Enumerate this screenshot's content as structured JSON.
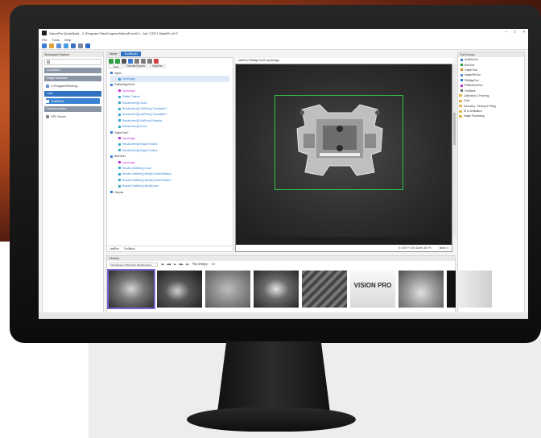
{
  "window": {
    "title": "VisionPro QuickBuild - C:\\Program Files\\Cognex\\VisionPro\\v9.0 - Job \"CFDT-MaskPr v9.0\"",
    "controls": [
      "–",
      "□",
      "×"
    ]
  },
  "menu": [
    "File",
    "Tools",
    "Help"
  ],
  "left_panel": {
    "header": "Workspace Explorer",
    "categories": [
      {
        "label": "Acquisition",
        "active": false
      },
      {
        "label": "Image Database",
        "active": false
      },
      {
        "label": "Jobs",
        "active": true
      },
      {
        "label": "Communication",
        "active": false
      }
    ],
    "items": {
      "image_db": "C:\\Program\\Files\\Img...",
      "job": "ToolBlock1",
      "comm": "OPC Server"
    }
  },
  "doc_tabs": [
    {
      "label": "Home",
      "active": false
    },
    {
      "label": "ToolBlock1",
      "active": true
    }
  ],
  "tree": {
    "tabs": [
      "Tools",
      "Results/Outputs",
      "Graphics"
    ],
    "nodes": [
      {
        "text": "Inputs",
        "level": 0
      },
      {
        "text": "InputImage",
        "level": 1,
        "style": "sel"
      },
      {
        "text": "PatMaxAlignTool1",
        "level": 0
      },
      {
        "text": "InputImage",
        "level": 1,
        "style": "mag"
      },
      {
        "text": "Pattern.Trained",
        "level": 1
      },
      {
        "text": "Results.Item[0].Score",
        "level": 1
      },
      {
        "text": "Results.Item[0].GetPose().TranslationX",
        "level": 1
      },
      {
        "text": "Results.Item[0].GetPose().TranslationY",
        "level": 1
      },
      {
        "text": "Results.Item[0].GetPose().Rotation",
        "level": 1
      },
      {
        "text": "Results.Item[0].Score",
        "level": 1
      },
      {
        "text": "CaliperTool1",
        "level": 0
      },
      {
        "text": "InputImage",
        "level": 1,
        "style": "mag"
      },
      {
        "text": "Results.Item[0].Edge0.Position",
        "level": 1
      },
      {
        "text": "Results.Item[0].Edge1.Position",
        "level": 1
      },
      {
        "text": "BlobTool1",
        "level": 0
      },
      {
        "text": "InputImage",
        "level": 1,
        "style": "mag"
      },
      {
        "text": "Results.GetBlobs().Count",
        "level": 1
      },
      {
        "text": "Results.GetBlobs().Item[0].CenterOfMassX",
        "level": 1
      },
      {
        "text": "Results.GetBlobs().Item[0].CenterOfMassY",
        "level": 1
      },
      {
        "text": "Results.GetBlobs().Item[0].Area",
        "level": 1
      },
      {
        "text": "Outputs",
        "level": 0
      }
    ],
    "footer": [
      "LastRun",
      "ToolBlock"
    ]
  },
  "viewer": {
    "header": "LastRun.PMAlignTool1.InputImage",
    "status": [
      "X: 0.00  Y: 0.00  Zoom: 36.7%",
      "Value: 0"
    ]
  },
  "right_panel": {
    "header": "Tool Groups",
    "tools": [
      "AcqFifoTool",
      "BlobTool",
      "CaliperTool",
      "ImageFileTool",
      "PMAlignTool",
      "PMRedLineTool",
      "ToolBlock"
    ],
    "folders": [
      "Calibration & Fixturing",
      "Color",
      "Geometry - Finding & Fitting",
      "ID & Verification",
      "Image Processing"
    ]
  },
  "filmstrip": {
    "header": "Filmstrip",
    "path": "InputImage.C:\\Program Files\\Cognex\\",
    "controls": [
      "|◀",
      "◀◀",
      "▶",
      "▶▶",
      "▶|"
    ],
    "play_label": "Play Delay(s):",
    "play_value": "0.0",
    "thumbs": [
      "",
      "",
      "",
      "",
      "",
      "VISION PRO",
      "",
      ""
    ]
  },
  "colors": {
    "accent": "#2f73c0",
    "roi": "#2fbf4a",
    "selection": "#7b63d8",
    "magenta": "#c234c8"
  }
}
